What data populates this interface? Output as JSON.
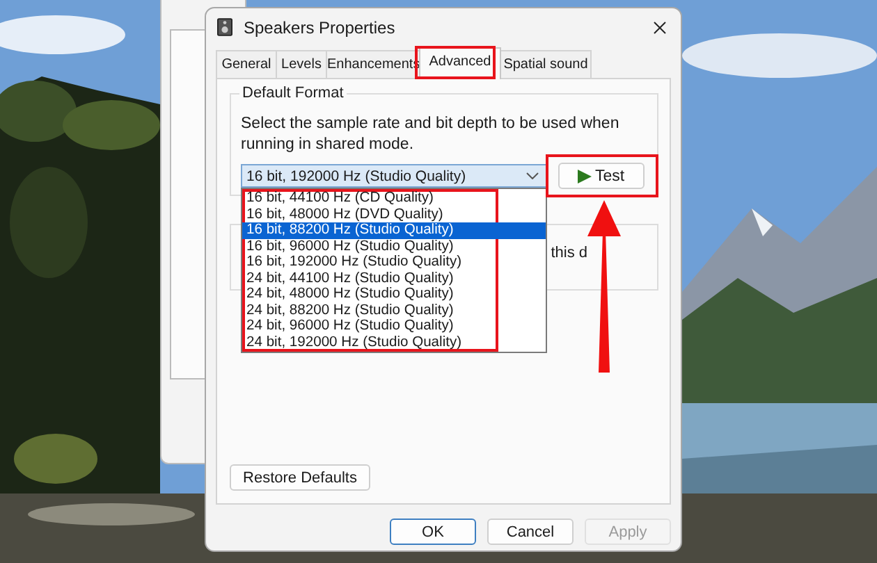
{
  "dialog": {
    "title": "Speakers Properties",
    "tabs": [
      {
        "label": "General",
        "selected": false
      },
      {
        "label": "Levels",
        "selected": false
      },
      {
        "label": "Enhancements",
        "selected": false
      },
      {
        "label": "Advanced",
        "selected": true
      },
      {
        "label": "Spatial sound",
        "selected": false
      }
    ],
    "default_format": {
      "title": "Default Format",
      "description": "Select the sample rate and bit depth to be used when running in shared mode.",
      "dropdown": {
        "value": "16 bit, 192000 Hz (Studio Quality)",
        "expanded": true,
        "options": [
          {
            "label": "16 bit, 44100 Hz (CD Quality)",
            "highlighted": false
          },
          {
            "label": "16 bit, 48000 Hz (DVD Quality)",
            "highlighted": false
          },
          {
            "label": "16 bit, 88200 Hz (Studio Quality)",
            "highlighted": true
          },
          {
            "label": "16 bit, 96000 Hz (Studio Quality)",
            "highlighted": false
          },
          {
            "label": "16 bit, 192000 Hz (Studio Quality)",
            "highlighted": false
          },
          {
            "label": "24 bit, 44100 Hz (Studio Quality)",
            "highlighted": false
          },
          {
            "label": "24 bit, 48000 Hz (Studio Quality)",
            "highlighted": false
          },
          {
            "label": "24 bit, 88200 Hz (Studio Quality)",
            "highlighted": false
          },
          {
            "label": "24 bit, 96000 Hz (Studio Quality)",
            "highlighted": false
          },
          {
            "label": "24 bit, 192000 Hz (Studio Quality)",
            "highlighted": false
          }
        ]
      },
      "test_button": "Test"
    },
    "exclusive_mode": {
      "partial_text": "this d"
    },
    "restore_button": "Restore Defaults",
    "buttons": [
      {
        "label": "OK",
        "disabled": false,
        "default": true
      },
      {
        "label": "Cancel",
        "disabled": false,
        "default": false
      },
      {
        "label": "Apply",
        "disabled": true,
        "default": false
      }
    ]
  }
}
